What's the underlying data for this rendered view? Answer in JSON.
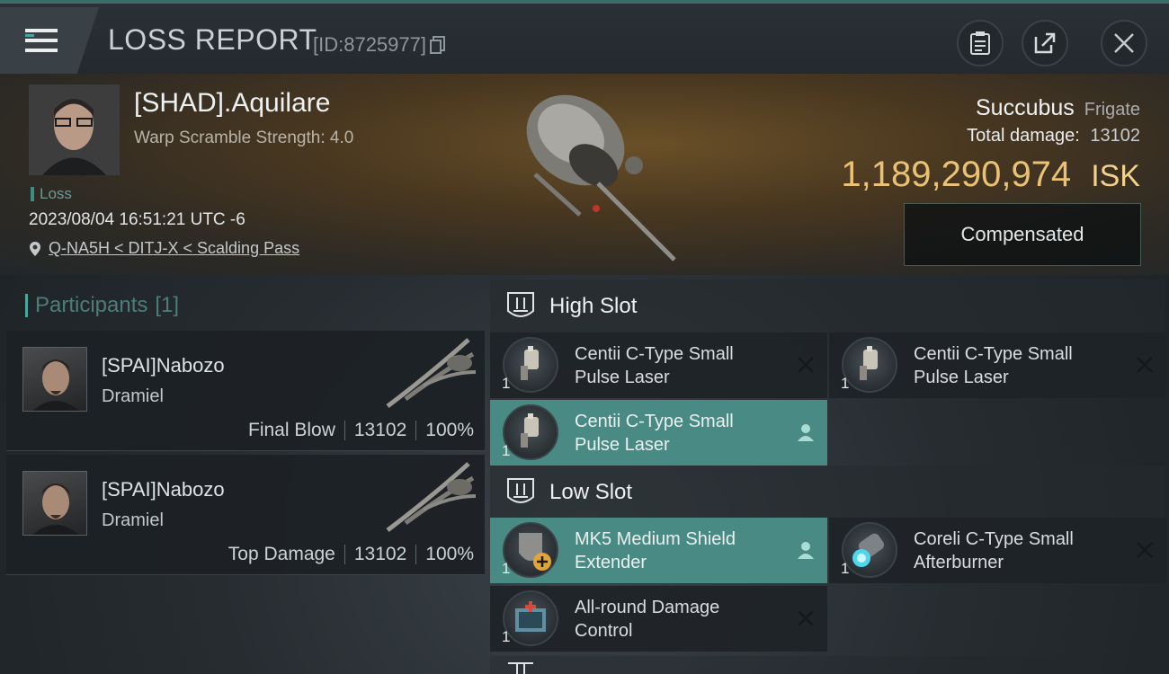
{
  "window": {
    "title": "LOSS REPORT",
    "report_id": "[ID:8725977]"
  },
  "victim": {
    "name": "[SHAD].Aquilare",
    "warp_scramble": "Warp Scramble Strength: 4.0",
    "status_tag": "Loss",
    "datetime": "2023/08/04 16:51:21 UTC -6",
    "location": "Q-NA5H < DITJ-X < Scalding Pass",
    "ship_name": "Succubus",
    "ship_class": "Frigate",
    "total_damage_label": "Total damage:",
    "total_damage": "13102",
    "isk_value": "1,189,290,974",
    "isk_unit": "ISK",
    "compensated_label": "Compensated"
  },
  "participants": {
    "title": "Participants",
    "count": "[1]",
    "items": [
      {
        "name": "[SPAI]Nabozo",
        "ship": "Dramiel",
        "role": "Final Blow",
        "damage": "13102",
        "percent": "100%"
      },
      {
        "name": "[SPAI]Nabozo",
        "ship": "Dramiel",
        "role": "Top Damage",
        "damage": "13102",
        "percent": "100%"
      }
    ]
  },
  "slots": {
    "high": {
      "label": "High Slot",
      "modules": [
        {
          "name": "Centii C-Type Small Pulse Laser",
          "qty": "1",
          "action": "x-icon"
        },
        {
          "name": "Centii C-Type Small Pulse Laser",
          "qty": "1",
          "action": "x-icon"
        },
        {
          "name": "Centii C-Type Small Pulse Laser",
          "qty": "1",
          "action": "person-icon"
        }
      ]
    },
    "low": {
      "label": "Low Slot",
      "modules": [
        {
          "name": "MK5 Medium Shield Extender",
          "qty": "1",
          "action": "person-icon"
        },
        {
          "name": "Coreli C-Type Small Afterburner",
          "qty": "1",
          "action": "x-icon"
        },
        {
          "name": "All-round Damage Control",
          "qty": "1",
          "action": "x-icon"
        }
      ]
    }
  },
  "colors": {
    "accent": "#4a8a84",
    "isk": "#e9c275",
    "loss": "#3e8c82"
  }
}
